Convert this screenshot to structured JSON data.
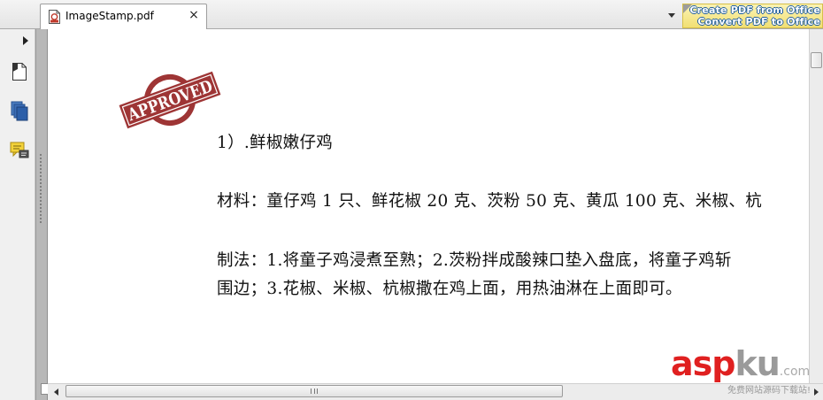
{
  "tab": {
    "title": "ImageStamp.pdf",
    "close": "×"
  },
  "promo": {
    "line1": "Create PDF from Office",
    "line2": "Convert PDF to Office"
  },
  "stamp": {
    "text": "APPROVED",
    "color": "#9e3535"
  },
  "document": {
    "lines": [
      "1）.鲜椒嫩仔鸡",
      "材料：童仔鸡 1 只、鲜花椒 20 克、茨粉 50 克、黄瓜 100 克、米椒、杭",
      "制法：1.将童子鸡浸煮至熟；2.茨粉拌成酸辣口垫入盘底，将童子鸡斩",
      "围边；3.花椒、米椒、杭椒撒在鸡上面，用热油淋在上面即可。"
    ]
  },
  "watermark": {
    "asp": "asp",
    "ku": "ku",
    "com": ".com",
    "sub": "免费网站源码下载站!"
  },
  "icons": {
    "tab": "pdf-file-icon",
    "sidebar": [
      "page-icon",
      "layers-icon",
      "comments-icon"
    ]
  }
}
